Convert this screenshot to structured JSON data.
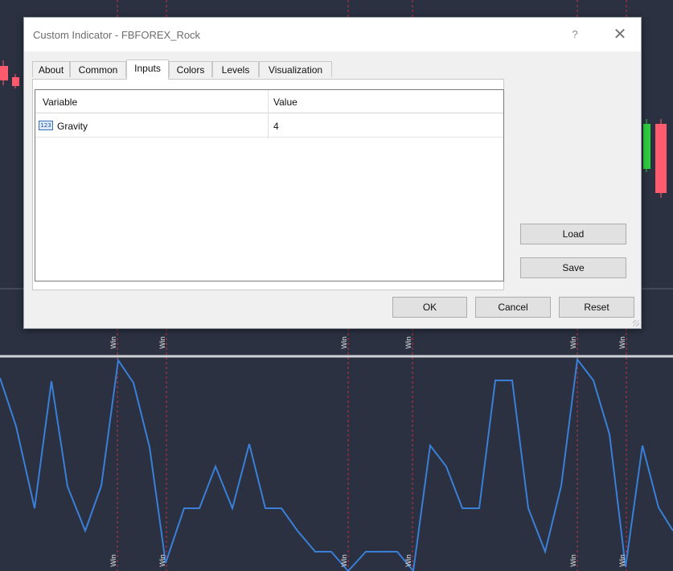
{
  "dialog": {
    "title": "Custom Indicator - FBFOREX_Rock",
    "help_label": "?",
    "close_label": "✕"
  },
  "tabs": [
    {
      "label": "About"
    },
    {
      "label": "Common"
    },
    {
      "label": "Inputs",
      "active": true
    },
    {
      "label": "Colors"
    },
    {
      "label": "Levels"
    },
    {
      "label": "Visualization"
    }
  ],
  "inputs_table": {
    "columns": [
      "Variable",
      "Value"
    ],
    "rows": [
      {
        "icon": "numeric-input-icon",
        "icon_text": "123",
        "variable": "Gravity",
        "value": "4"
      }
    ]
  },
  "side_buttons": {
    "load": "Load",
    "save": "Save"
  },
  "footer_buttons": {
    "ok": "OK",
    "cancel": "Cancel",
    "reset": "Reset"
  },
  "background_chart": {
    "marker_label": "Win",
    "colors": {
      "background": "#2b3140",
      "indicator_line": "#3a7fd8",
      "signal_lines": "#c2334a",
      "bullish_candle": "#2ecc40",
      "bearish_candle": "#ff5b6e",
      "separator": "#d0d0d0"
    }
  }
}
